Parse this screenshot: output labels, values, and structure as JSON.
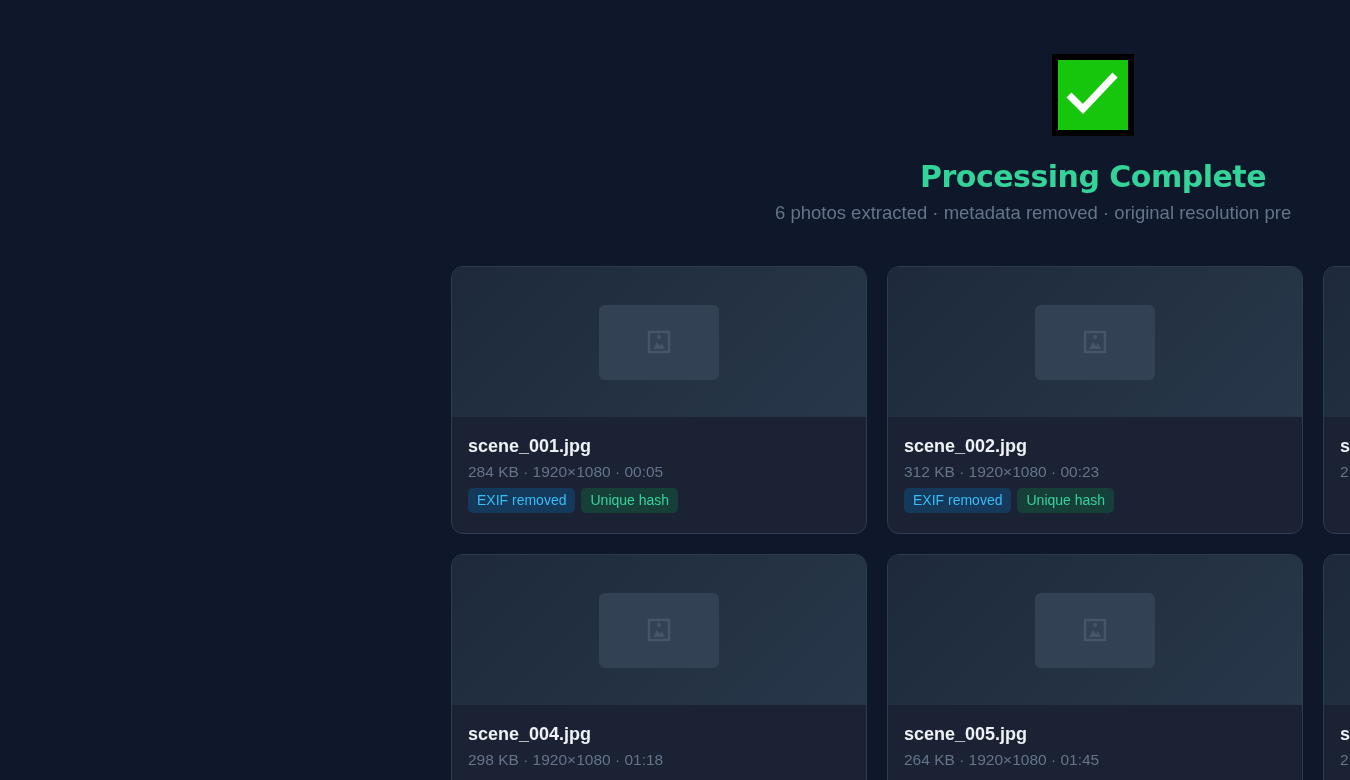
{
  "header": {
    "title": "Processing Complete",
    "subtitle": "6 photos extracted · metadata removed · original resolution pre"
  },
  "photos": [
    {
      "name": "scene_001.jpg",
      "meta": "284 KB · 1920×1080 · 00:05",
      "badges": [
        {
          "label": "EXIF removed",
          "kind": "exif"
        },
        {
          "label": "Unique hash",
          "kind": "hash"
        }
      ]
    },
    {
      "name": "scene_002.jpg",
      "meta": "312 KB · 1920×1080 · 00:23",
      "badges": [
        {
          "label": "EXIF removed",
          "kind": "exif"
        },
        {
          "label": "Unique hash",
          "kind": "hash"
        }
      ]
    },
    {
      "name": "s",
      "meta": "2"
    },
    {
      "name": "scene_004.jpg",
      "meta": "298 KB · 1920×1080 · 01:18"
    },
    {
      "name": "scene_005.jpg",
      "meta": "264 KB · 1920×1080 · 01:45"
    },
    {
      "name": "s",
      "meta": "2"
    }
  ]
}
